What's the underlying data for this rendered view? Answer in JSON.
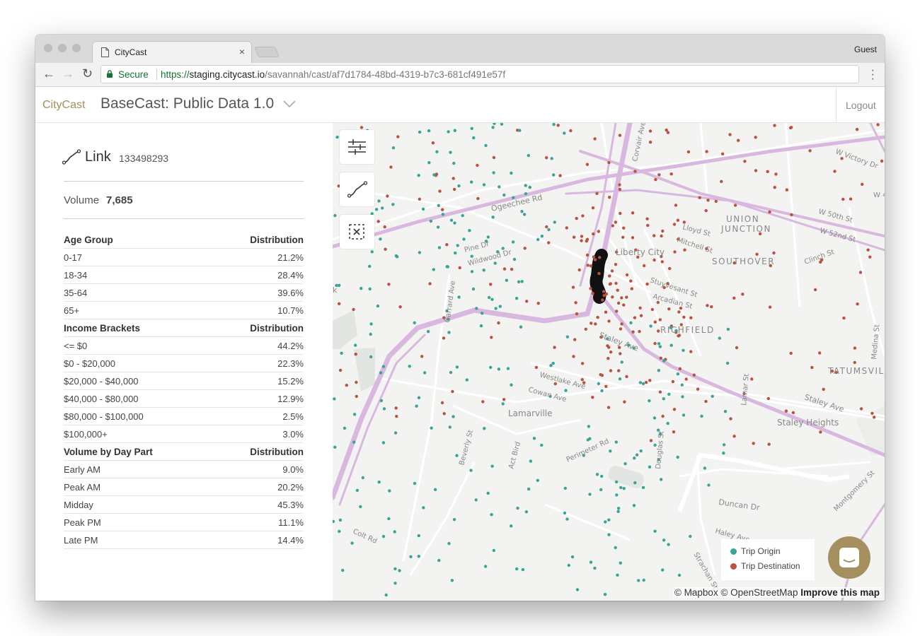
{
  "browser": {
    "tab_title": "CityCast",
    "tab_close": "×",
    "profile": "Guest",
    "secure_label": "Secure",
    "url_scheme": "https://",
    "url_host": "staging.citycast.io",
    "url_path": "/savannah/cast/af7d1784-48bd-4319-b7c3-681cf491e57f"
  },
  "app": {
    "brand": "CityCast",
    "title": "BaseCast: Public Data 1.0",
    "logout": "Logout"
  },
  "panel": {
    "link_label": "Link",
    "link_id": "133498293",
    "volume_label": "Volume",
    "volume_value": "7,685",
    "age_header": [
      "Age Group",
      "Distribution"
    ],
    "age_rows": [
      [
        "0-17",
        "21.2%"
      ],
      [
        "18-34",
        "28.4%"
      ],
      [
        "35-64",
        "39.6%"
      ],
      [
        "65+",
        "10.7%"
      ]
    ],
    "income_header": [
      "Income Brackets",
      "Distribution"
    ],
    "income_rows": [
      [
        "<= $0",
        "44.2%"
      ],
      [
        "$0 - $20,000",
        "22.3%"
      ],
      [
        "$20,000 - $40,000",
        "15.2%"
      ],
      [
        "$40,000 - $80,000",
        "12.9%"
      ],
      [
        "$80,000 - $100,000",
        "2.5%"
      ],
      [
        "$100,000+",
        "3.0%"
      ]
    ],
    "daypart_header": [
      "Volume by Day Part",
      "Distribution"
    ],
    "daypart_rows": [
      [
        "Early AM",
        "9.0%"
      ],
      [
        "Peak AM",
        "20.2%"
      ],
      [
        "Midday",
        "45.3%"
      ],
      [
        "Peak PM",
        "11.1%"
      ],
      [
        "Late PM",
        "14.4%"
      ]
    ]
  },
  "map": {
    "labels": {
      "union": "UNION",
      "junction": "JUNCTION",
      "southover": "SOUTHOVER",
      "richfield": "RICHFIELD",
      "tatumsville": "TATUMSVILL",
      "liberty_city": "Liberty City",
      "lamarville": "Lamarville",
      "staley_heights": "Staley Heights",
      "ogeechee": "Ogeechee Rd",
      "corvair": "Corvair Ave",
      "victory": "W Victory Dr",
      "w50th": "W 50th St",
      "w52nd": "W 52nd St",
      "w4": "W 4",
      "lloyd": "Lloyd St",
      "mitchell": "Mitchell St",
      "clinch": "Clinch St",
      "stuyvesant": "Stuyvesant St",
      "arcadian": "Arcadian St",
      "staley_ave": "Staley Ave",
      "staley_ave2": "Staley Ave",
      "pine": "Pine Dr",
      "wildwood": "Wildwood Dr",
      "garrard": "Garrard Ave",
      "westlake": "Westlake Ave",
      "cowan": "Cowan Ave",
      "beverly": "Beverly St",
      "actbird": "Act Bird",
      "perimeter": "Perimeter Rd",
      "douglas": "Douglas St",
      "lamar": "Lamar St",
      "duncan": "Duncan Dr",
      "haley": "Haley Ave",
      "strachan": "Strachan St",
      "montgomery": "Montgomery St",
      "medina": "Medina St",
      "colt": "Colt Rd",
      "k": "k"
    },
    "legend_origin": "Trip Origin",
    "legend_destination": "Trip Destination",
    "colors": {
      "origin": "#3aa39a",
      "destination": "#b9523f",
      "road": "#d9b8df",
      "selected_link": "#111111"
    },
    "attribution": "© Mapbox © OpenStreetMap",
    "improve": "Improve this map"
  }
}
